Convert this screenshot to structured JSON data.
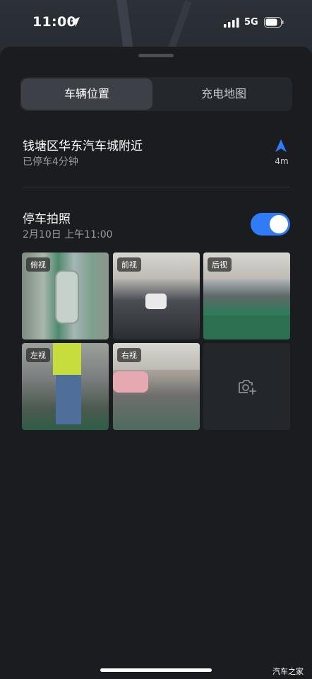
{
  "status_bar": {
    "time": "11:00",
    "network": "5G",
    "location_icon": "location-arrow-icon",
    "signal_icon": "signal-bars-icon",
    "battery_icon": "battery-icon"
  },
  "tabs": [
    {
      "label": "车辆位置",
      "selected": true
    },
    {
      "label": "充电地图",
      "selected": false
    }
  ],
  "location": {
    "place": "钱塘区华东汽车城附近",
    "parked": "已停车4分钟",
    "distance": "4m",
    "nav_icon": "navigation-arrow-icon"
  },
  "parking_photos": {
    "title": "停车拍照",
    "date": "2月10日  上午11:00",
    "toggle_on": true,
    "photos": [
      {
        "label": "俯视"
      },
      {
        "label": "前视"
      },
      {
        "label": "后视"
      },
      {
        "label": "左视"
      },
      {
        "label": "右视"
      }
    ],
    "add_icon": "camera-plus-icon"
  },
  "colors": {
    "accent": "#2f7cf6",
    "background": "#1a1c20"
  },
  "watermark": "汽车之家"
}
